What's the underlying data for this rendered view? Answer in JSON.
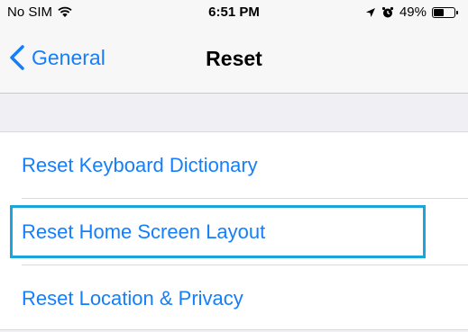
{
  "status_bar": {
    "carrier": "No SIM",
    "time": "6:51 PM",
    "battery_percent": "49%",
    "battery_level": 0.49,
    "icons": [
      "wifi-icon",
      "location-arrow-icon",
      "alarm-icon",
      "battery-icon"
    ]
  },
  "nav": {
    "back_label": "General",
    "title": "Reset"
  },
  "reset_options": [
    {
      "label": "Reset Keyboard Dictionary"
    },
    {
      "label": "Reset Home Screen Layout",
      "highlighted": true
    },
    {
      "label": "Reset Location & Privacy"
    }
  ],
  "colors": {
    "accent": "#157efb",
    "highlight": "#1ca4dc",
    "background": "#efeff4"
  }
}
